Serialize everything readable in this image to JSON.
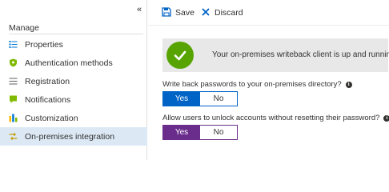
{
  "sidebar": {
    "collapse_glyph": "«",
    "section_title": "Manage",
    "items": [
      {
        "label": "Properties",
        "icon": "properties-icon",
        "active": false
      },
      {
        "label": "Authentication methods",
        "icon": "shield-icon",
        "active": false
      },
      {
        "label": "Registration",
        "icon": "list-icon",
        "active": false
      },
      {
        "label": "Notifications",
        "icon": "notification-icon",
        "active": false
      },
      {
        "label": "Customization",
        "icon": "bar-chart-icon",
        "active": false
      },
      {
        "label": "On-premises integration",
        "icon": "sync-icon",
        "active": true
      }
    ]
  },
  "toolbar": {
    "save_label": "Save",
    "discard_label": "Discard"
  },
  "banner": {
    "message": "Your on-premises writeback client is up and running.",
    "status_color": "#57a300"
  },
  "settings": {
    "writeback": {
      "question": "Write back passwords to your on-premises directory?",
      "yes_label": "Yes",
      "no_label": "No",
      "selected": "Yes"
    },
    "unlock": {
      "question": "Allow users to unlock accounts without resetting their password?",
      "yes_label": "Yes",
      "no_label": "No",
      "selected": "Yes"
    }
  },
  "colors": {
    "accent": "#0063c6",
    "accent_alt": "#6a2d8c",
    "active_nav": "#dce9f5"
  }
}
